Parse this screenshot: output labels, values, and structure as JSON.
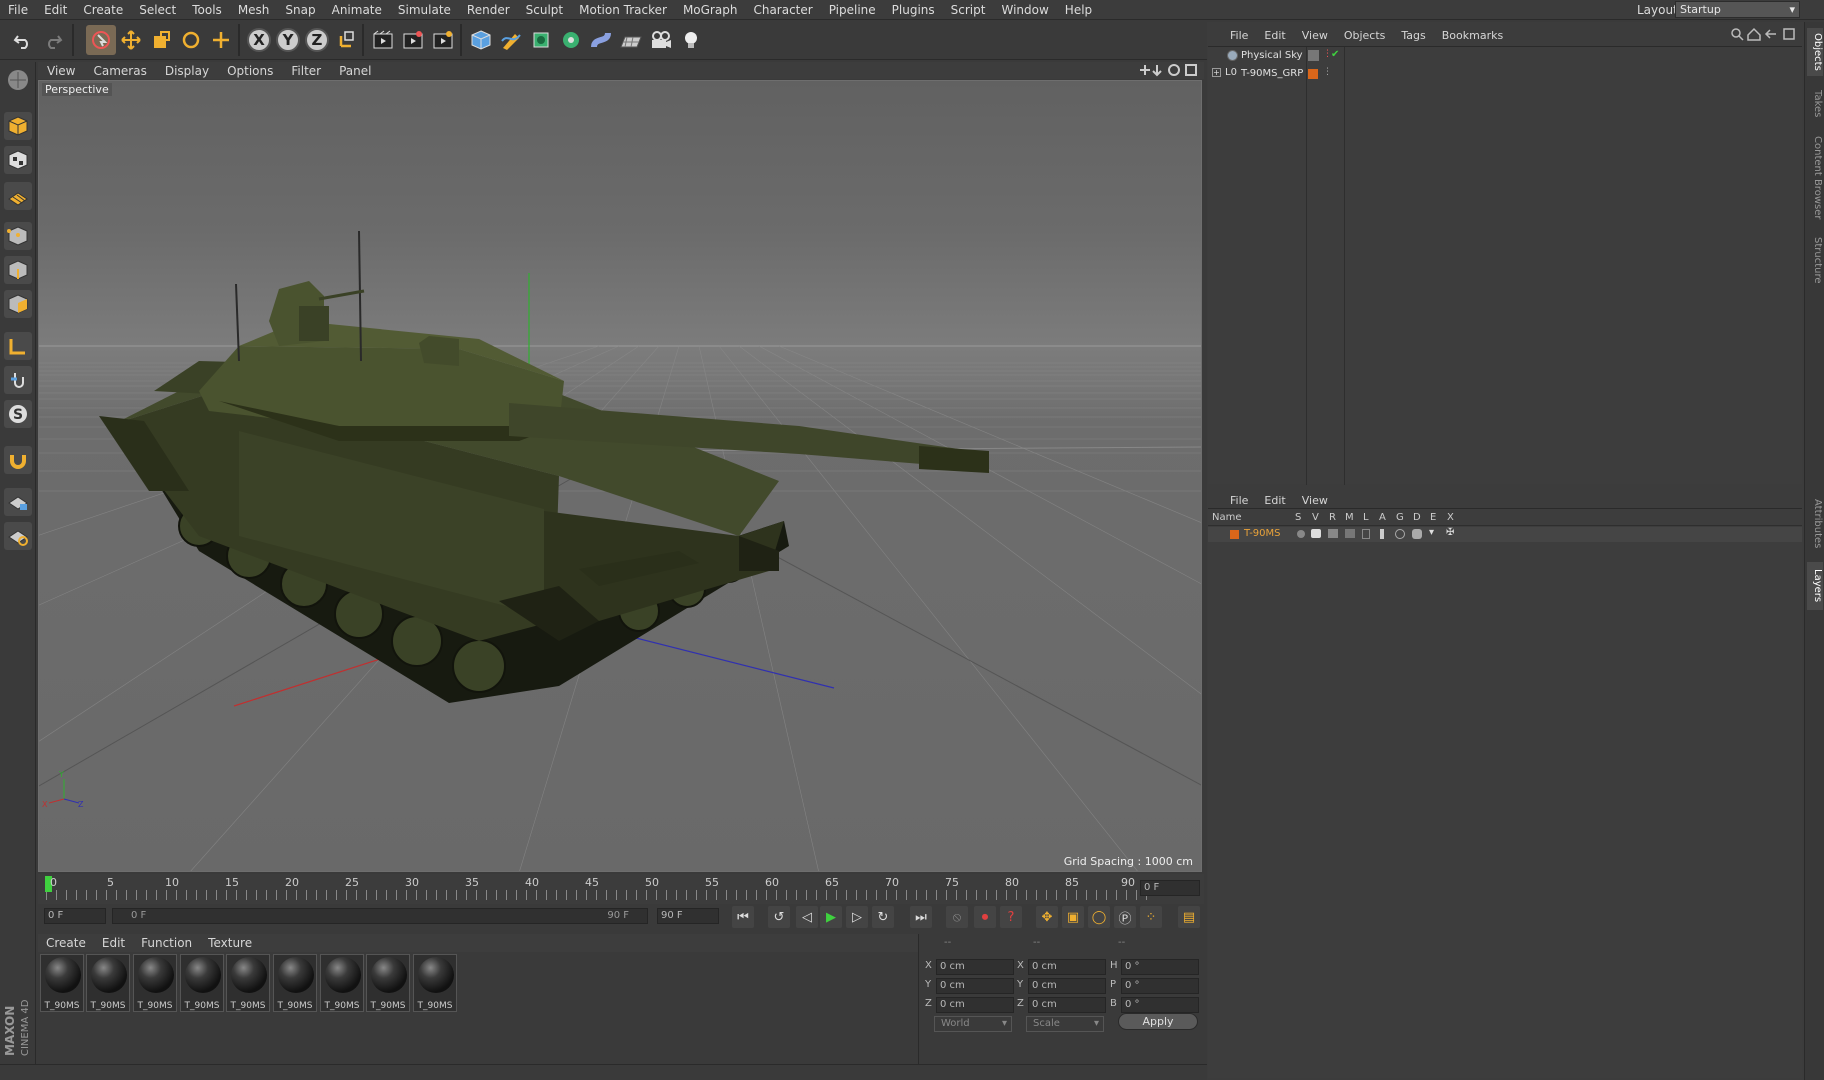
{
  "app": {
    "name": "Cinema 4D",
    "brand_top": "MAXON",
    "brand_bottom": "CINEMA 4D"
  },
  "menubar": {
    "items": [
      "File",
      "Edit",
      "Create",
      "Select",
      "Tools",
      "Mesh",
      "Snap",
      "Animate",
      "Simulate",
      "Render",
      "Sculpt",
      "Motion Tracker",
      "MoGraph",
      "Character",
      "Pipeline",
      "Plugins",
      "Script",
      "Window",
      "Help"
    ],
    "layout_label": "Layout:",
    "layout_value": "Startup"
  },
  "viewport": {
    "menu": [
      "View",
      "Cameras",
      "Display",
      "Options",
      "Filter",
      "Panel"
    ],
    "camera_label": "Perspective",
    "grid_spacing": "Grid Spacing : 1000 cm",
    "axis_labels": {
      "x": "X",
      "y": "Y",
      "z": "Z"
    }
  },
  "timeline": {
    "ticks": [
      "0",
      "5",
      "10",
      "15",
      "20",
      "25",
      "30",
      "35",
      "40",
      "45",
      "50",
      "55",
      "60",
      "65",
      "70",
      "75",
      "80",
      "85",
      "90"
    ],
    "current_frame": "0 F",
    "start_field": "0 F",
    "range_start": "0 F",
    "range_end": "90 F",
    "end_field": "90 F"
  },
  "material_manager": {
    "menu": [
      "Create",
      "Edit",
      "Function",
      "Texture"
    ],
    "materials": [
      "T_90MS",
      "T_90MS",
      "T_90MS",
      "T_90MS",
      "T_90MS",
      "T_90MS",
      "T_90MS",
      "T_90MS",
      "T_90MS"
    ]
  },
  "coordinates": {
    "header_left": "--",
    "header_mid": "--",
    "header_right": "--",
    "rows": [
      {
        "pos_label": "X",
        "pos": "0 cm",
        "size_label": "X",
        "size": "0 cm",
        "rot_label": "H",
        "rot": "0 °"
      },
      {
        "pos_label": "Y",
        "pos": "0 cm",
        "size_label": "Y",
        "size": "0 cm",
        "rot_label": "P",
        "rot": "0 °"
      },
      {
        "pos_label": "Z",
        "pos": "0 cm",
        "size_label": "Z",
        "size": "0 cm",
        "rot_label": "B",
        "rot": "0 °"
      }
    ],
    "mode": "World",
    "size_mode": "Scale",
    "apply": "Apply"
  },
  "object_manager": {
    "menu": [
      "File",
      "Edit",
      "View",
      "Objects",
      "Tags",
      "Bookmarks"
    ],
    "objects": [
      {
        "name": "Physical Sky"
      },
      {
        "name": "T-90MS_GRP",
        "layer_color": "#d9661a"
      }
    ]
  },
  "layer_manager": {
    "menu": [
      "File",
      "Edit",
      "View"
    ],
    "columns": [
      "Name",
      "S",
      "V",
      "R",
      "M",
      "L",
      "A",
      "G",
      "D",
      "E",
      "X"
    ],
    "layers": [
      {
        "name": "T-90MS",
        "color": "#d9661a"
      }
    ]
  },
  "side_tabs": [
    "Objects",
    "Takes",
    "Content Browser",
    "Structure",
    "Attributes",
    "Layers"
  ],
  "colors": {
    "accent": "#e8a23a",
    "layer": "#d9661a",
    "play": "#3fd13f"
  }
}
